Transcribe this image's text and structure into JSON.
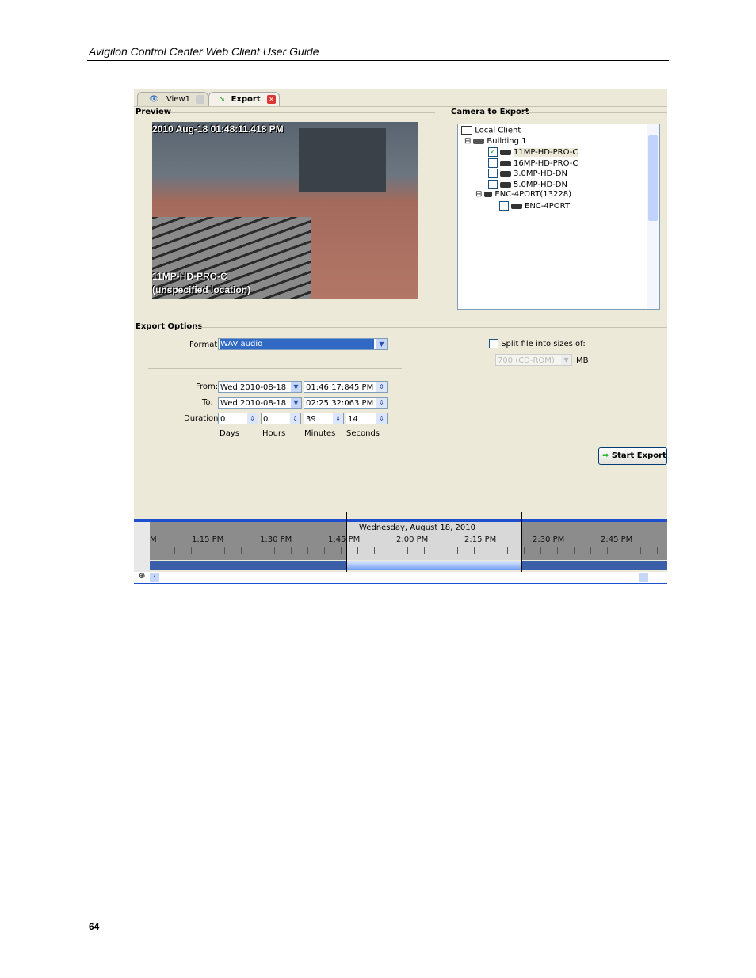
{
  "header": {
    "title": "Avigilon Control Center Web Client User Guide"
  },
  "footer": {
    "page_number": "64"
  },
  "app": {
    "tabs": [
      {
        "label": "View1",
        "icon": "eye-icon"
      },
      {
        "label": "Export",
        "icon": "export-arrow-icon"
      }
    ],
    "preview": {
      "label": "Preview",
      "timestamp": "2010 Aug-18 01:48:11.418 PM",
      "camera_name": "11MP-HD-PRO-C",
      "location": "(unspecified location)"
    },
    "camera_to_export": {
      "label": "Camera to Export",
      "root": "Local Client",
      "site": "Building 1",
      "cameras": [
        {
          "name": "11MP-HD-PRO-C",
          "checked": true
        },
        {
          "name": "16MP-HD-PRO-C",
          "checked": false
        },
        {
          "name": "3.0MP-HD-DN",
          "checked": false
        },
        {
          "name": "5.0MP-HD-DN",
          "checked": false
        }
      ],
      "encoder": "ENC-4PORT(13228)",
      "encoder_camera": {
        "name": "ENC-4PORT",
        "checked": false
      }
    },
    "export_options": {
      "label": "Export Options",
      "format_label": "Format:",
      "format_value": "WAV audio",
      "from_label": "From:",
      "from_date": "Wed 2010-08-18",
      "from_time": "01:46:17:845  PM",
      "to_label": "To:",
      "to_date": "Wed 2010-08-18",
      "to_time": "02:25:32:063  PM",
      "duration_label": "Duration:",
      "duration": [
        "0",
        "0",
        "39",
        "14"
      ],
      "duration_units": [
        "Days",
        "Hours",
        "Minutes",
        "Seconds"
      ],
      "split_label": "Split file into sizes of:",
      "split_checked": false,
      "split_size": "700 (CD-ROM)",
      "split_unit": "MB",
      "start_export": "Start Export"
    },
    "timeline": {
      "date": "Wednesday, August 18, 2010",
      "ticks": [
        "M",
        "1:15 PM",
        "1:30 PM",
        "1:45 PM",
        "2:00 PM",
        "2:15 PM",
        "2:30 PM",
        "2:45 PM"
      ]
    }
  }
}
